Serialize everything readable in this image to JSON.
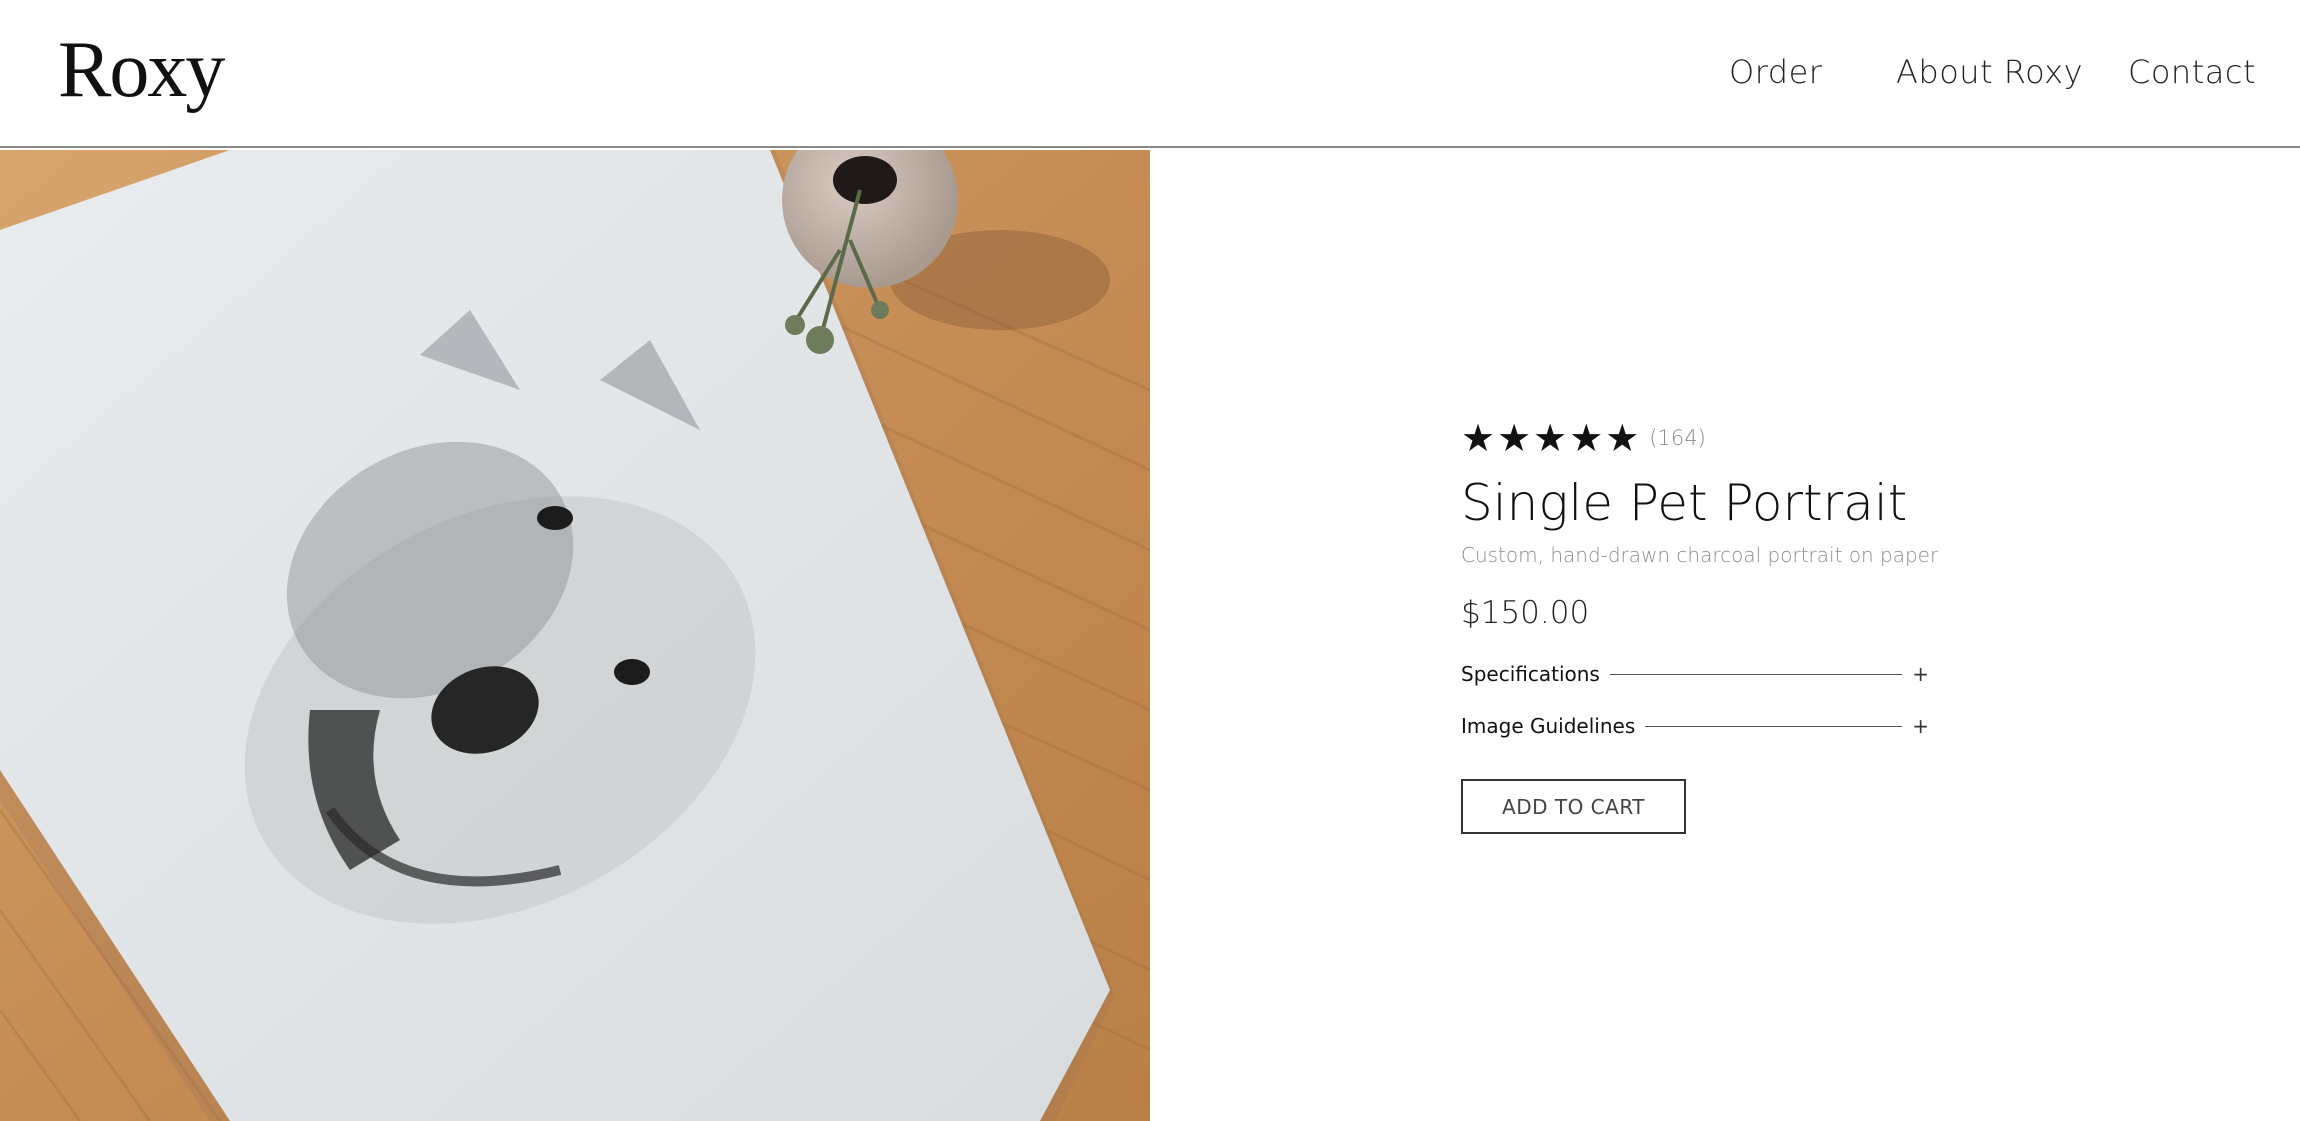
{
  "header": {
    "logo": "Roxy",
    "nav": {
      "order": "Order",
      "about": "About Roxy",
      "contact": "Contact"
    }
  },
  "product": {
    "stars": "★★★★★",
    "rating": 5,
    "review_count": "(164)",
    "title": "Single Pet Portrait",
    "subtitle": "Custom, hand-drawn charcoal portrait on paper",
    "price": "$150.00",
    "accordions": [
      {
        "label": "Specifications",
        "icon": "+"
      },
      {
        "label": "Image Guidelines",
        "icon": "+"
      }
    ],
    "add_to_cart_label": "ADD TO CART"
  },
  "colors": {
    "text": "#111111",
    "muted": "#8d8d8d",
    "divider": "#8a8a8a",
    "wood": "#c9925a",
    "paper": "#e4e7e8"
  }
}
